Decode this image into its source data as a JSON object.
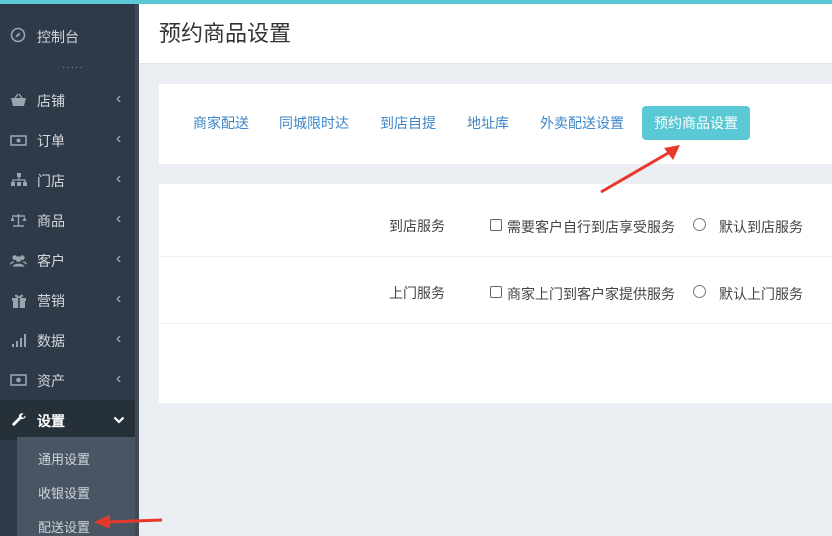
{
  "colors": {
    "accent": "#5bc8d6",
    "sidebar_bg": "#2f3a48",
    "link": "#3d86c9",
    "annotation": "#e8382c"
  },
  "sidebar": {
    "dashboard_label": "控制台",
    "dots": "·····",
    "items": [
      {
        "label": "店铺",
        "icon": "basket-icon"
      },
      {
        "label": "订单",
        "icon": "money-icon"
      },
      {
        "label": "门店",
        "icon": "sitemap-icon"
      },
      {
        "label": "商品",
        "icon": "scale-icon"
      },
      {
        "label": "客户",
        "icon": "users-icon"
      },
      {
        "label": "营销",
        "icon": "gift-icon"
      },
      {
        "label": "数据",
        "icon": "signal-icon"
      },
      {
        "label": "资产",
        "icon": "cash-icon"
      },
      {
        "label": "设置",
        "icon": "wrench-icon"
      }
    ],
    "sub_items": [
      {
        "label": "通用设置"
      },
      {
        "label": "收银设置"
      },
      {
        "label": "配送设置"
      }
    ]
  },
  "header": {
    "title": "预约商品设置"
  },
  "tabs": [
    {
      "label": "商家配送"
    },
    {
      "label": "同城限时达"
    },
    {
      "label": "到店自提"
    },
    {
      "label": "地址库"
    },
    {
      "label": "外卖配送设置"
    },
    {
      "label": "预约商品设置"
    }
  ],
  "form": {
    "rows": [
      {
        "label": "到店服务",
        "checkbox_label": "需要客户自行到店享受服务",
        "radio_label": "默认到店服务"
      },
      {
        "label": "上门服务",
        "checkbox_label": "商家上门到客户家提供服务",
        "radio_label": "默认上门服务"
      }
    ]
  }
}
